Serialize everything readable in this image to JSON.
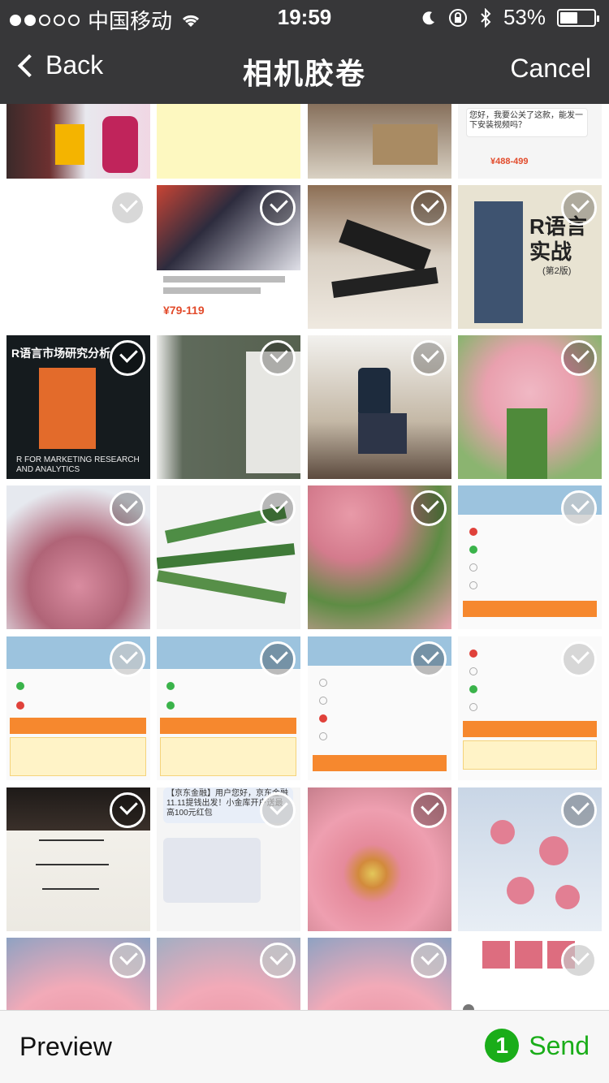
{
  "status_bar": {
    "carrier": "中国移动",
    "time": "19:59",
    "battery": "53%",
    "battery_level": 0.53,
    "icons": [
      "signal-dots",
      "wifi-icon",
      "moon-icon",
      "lock-rotation-icon",
      "bluetooth-icon",
      "battery-icon"
    ]
  },
  "nav": {
    "back_label": "Back",
    "title": "相机胶卷",
    "cancel_label": "Cancel"
  },
  "bottom": {
    "preview_label": "Preview",
    "selected_count": "1",
    "send_label": "Send"
  },
  "photos": [
    {
      "desc": "fitness ad banner",
      "checked": true
    },
    {
      "desc": "yellow note",
      "checked": true
    },
    {
      "desc": "cardboard box",
      "checked": true
    },
    {
      "desc": "chat screenshot",
      "checked": true
    },
    {
      "desc": "blank white",
      "checked": true
    },
    {
      "desc": "ab machine ad",
      "checked": true
    },
    {
      "desc": "exercise bench",
      "checked": true
    },
    {
      "desc": "R book cover",
      "checked": true
    },
    {
      "desc": "R market research book",
      "checked": true
    },
    {
      "desc": "book inside page",
      "checked": true
    },
    {
      "desc": "person on machine",
      "checked": true
    },
    {
      "desc": "pink flowers bouquet",
      "checked": true
    },
    {
      "desc": "pink gerbera",
      "checked": true
    },
    {
      "desc": "flower stems",
      "checked": true
    },
    {
      "desc": "bouquet stems",
      "checked": true
    },
    {
      "desc": "driving quiz",
      "checked": true
    },
    {
      "desc": "driving quiz",
      "checked": true
    },
    {
      "desc": "driving quiz",
      "checked": true
    },
    {
      "desc": "driving quiz",
      "checked": true
    },
    {
      "desc": "driving quiz",
      "checked": true
    },
    {
      "desc": "handwritten card",
      "checked": true
    },
    {
      "desc": "sms screenshot",
      "checked": true
    },
    {
      "desc": "pink gerbera closeup",
      "checked": true
    },
    {
      "desc": "flowers on table",
      "checked": true
    },
    {
      "desc": "gerbera",
      "checked": true
    },
    {
      "desc": "gerbera",
      "checked": true
    },
    {
      "desc": "gerbera side",
      "checked": true
    },
    {
      "desc": "chat with photos",
      "checked": true
    }
  ],
  "texts": {
    "tile_r_book": "R语言实战",
    "tile_r_book_ed": "(第2版)",
    "tile_market": "R语言市场研究分析",
    "tile_market_en": "R FOR MARKETING RESEARCH AND ANALYTICS",
    "tile_ad_price": "¥79-119",
    "tile_chat_q": "您好，我要公关了这款，能发一下安装视频吗？",
    "tile_chat_price": "¥488-499",
    "tile_sms": "【京东金融】用户您好，京东金融11.11提钱出发！小金库开户送最高100元红包"
  },
  "colors": {
    "send_green": "#1aad19",
    "header_dark": "#262628"
  }
}
